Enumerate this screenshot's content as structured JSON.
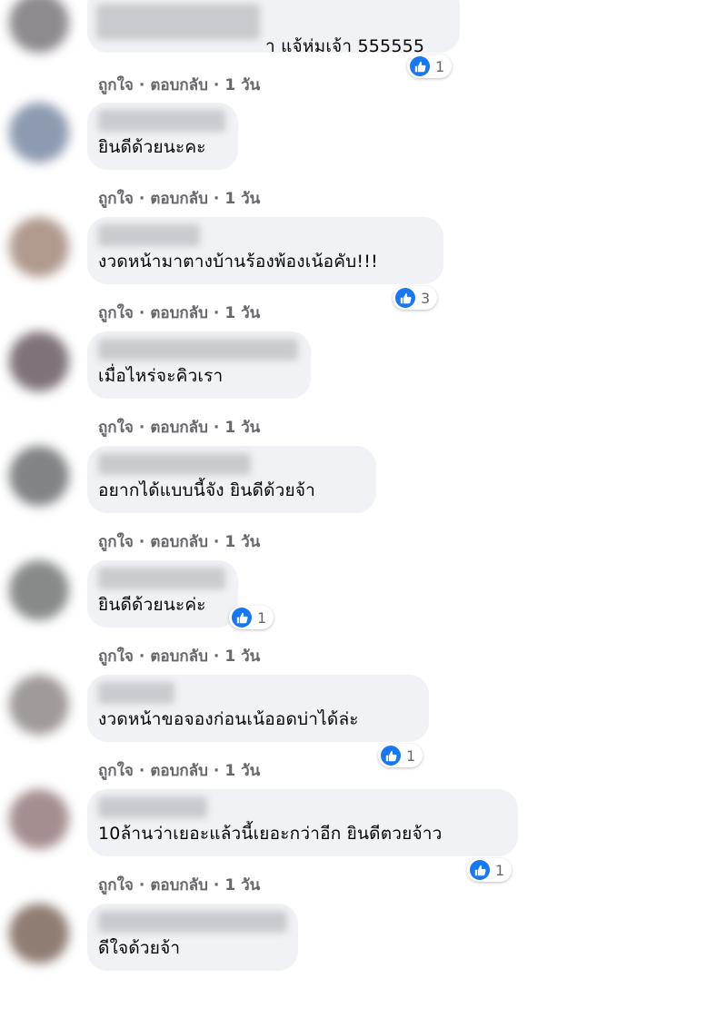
{
  "meta": {
    "like_label": "ถูกใจ",
    "reply_label": "ตอบกลับ",
    "separator": "·"
  },
  "comments": [
    {
      "text": "า แจ้ห่มเจ้า 555555",
      "time": "1 วัน",
      "reactions": "1"
    },
    {
      "text": "ยินดีด้วยนะคะ",
      "time": "1 วัน",
      "reactions": ""
    },
    {
      "text": "งวดหน้ามาตางบ้านร้องพ้องเน้อคับ!!!",
      "time": "1 วัน",
      "reactions": "3"
    },
    {
      "text": "เมื่อไหร่จะคิวเรา",
      "time": "1 วัน",
      "reactions": ""
    },
    {
      "text": "อยากได้แบบนี้จัง ยินดีด้วยจ้า",
      "time": "1 วัน",
      "reactions": ""
    },
    {
      "text": "ยินดีด้วยนะค่ะ",
      "time": "1 วัน",
      "reactions": "1"
    },
    {
      "text": "งวดหน้าขอจองก่อนเน้ออดบ่าได้ล่ะ",
      "time": "1 วัน",
      "reactions": "1"
    },
    {
      "text": "10ล้านว่าเยอะแล้วนี้เยอะกว่าอีก ยินดีตวยจ้าว",
      "time": "1 วัน",
      "reactions": "1"
    },
    {
      "text": "ดีใจด้วยจ้า",
      "time": "",
      "reactions": ""
    }
  ]
}
